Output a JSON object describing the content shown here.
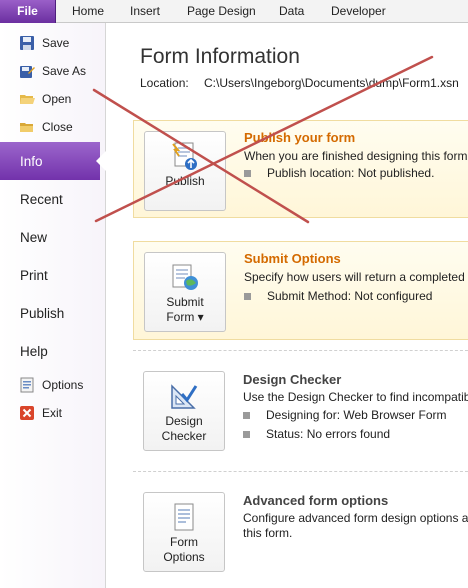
{
  "ribbon": {
    "tabs": [
      "File",
      "Home",
      "Insert",
      "Page Design",
      "Data",
      "Developer"
    ]
  },
  "sidebar": {
    "commands": [
      {
        "label": "Save",
        "icon": "save-icon"
      },
      {
        "label": "Save As",
        "icon": "save-as-icon"
      },
      {
        "label": "Open",
        "icon": "open-folder-icon"
      },
      {
        "label": "Close",
        "icon": "close-folder-icon"
      }
    ],
    "pages": [
      "Info",
      "Recent",
      "New",
      "Print",
      "Publish",
      "Help"
    ],
    "selected": "Info",
    "footer": [
      {
        "label": "Options",
        "icon": "options-icon"
      },
      {
        "label": "Exit",
        "icon": "exit-icon"
      }
    ]
  },
  "main": {
    "title": "Form Information",
    "location_label": "Location:",
    "location_path": "C:\\Users\\Ingeborg\\Documents\\dump\\Form1.xsn",
    "sections": [
      {
        "button": [
          "Publish"
        ],
        "title": "Publish your form",
        "description": [
          "When you are finished designing this form,"
        ],
        "bullets": [
          "Publish location: Not published."
        ]
      },
      {
        "button": [
          "Submit",
          "Form ▾"
        ],
        "title": "Submit Options",
        "description": [
          "Specify how users will return a completed f"
        ],
        "bullets": [
          "Submit Method: Not configured"
        ]
      },
      {
        "button": [
          "Design",
          "Checker"
        ],
        "title": "Design Checker",
        "description": [
          "Use the Design Checker to find incompatib"
        ],
        "bullets": [
          "Designing for: Web Browser Form",
          "Status: No errors found"
        ]
      },
      {
        "button": [
          "Form",
          "Options"
        ],
        "title": "Advanced form options",
        "description": [
          "Configure advanced form design options a",
          "this form."
        ],
        "bullets": []
      }
    ]
  },
  "colors": {
    "file_tab": "#7232ab",
    "highlight_title": "#d46a00",
    "cross_out": "#c0504d"
  }
}
